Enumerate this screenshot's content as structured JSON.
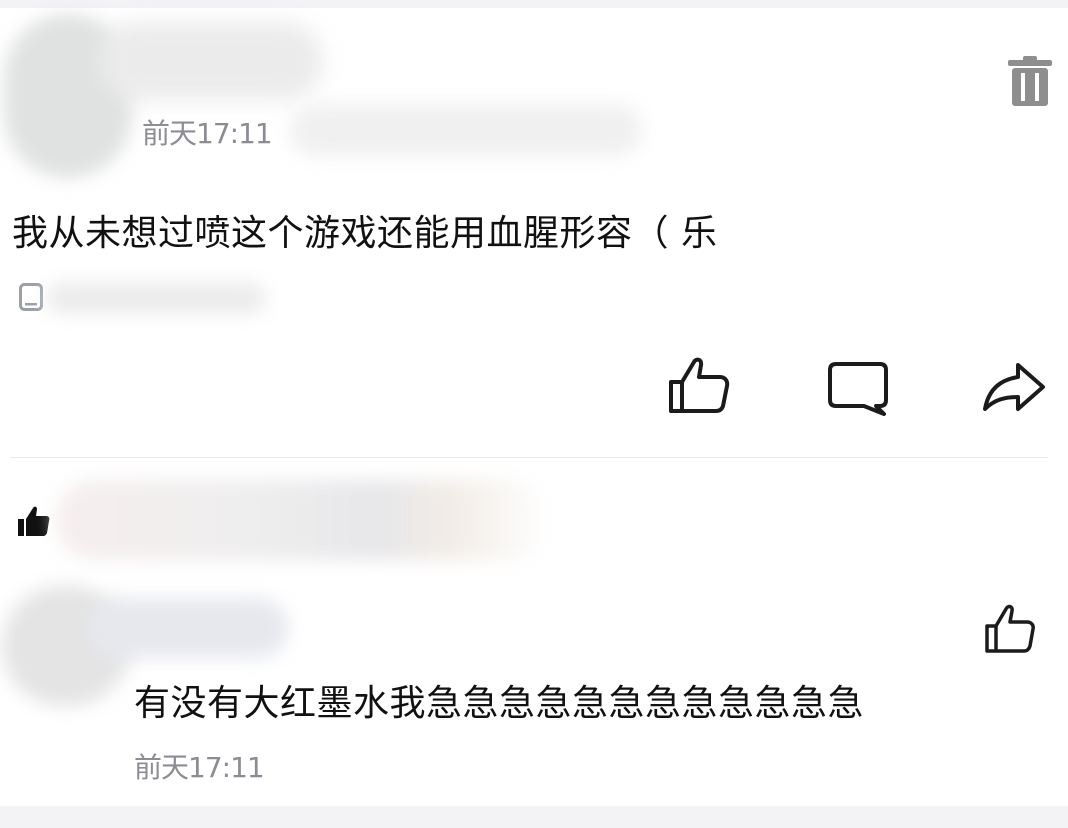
{
  "post": {
    "timestamp": "前天17:11",
    "text": "我从未想过喷这个游戏还能用血腥形容（ 乐"
  },
  "reply": {
    "text": "有没有大红墨水我急急急急急急急急急急急急",
    "timestamp": "前天17:11"
  }
}
